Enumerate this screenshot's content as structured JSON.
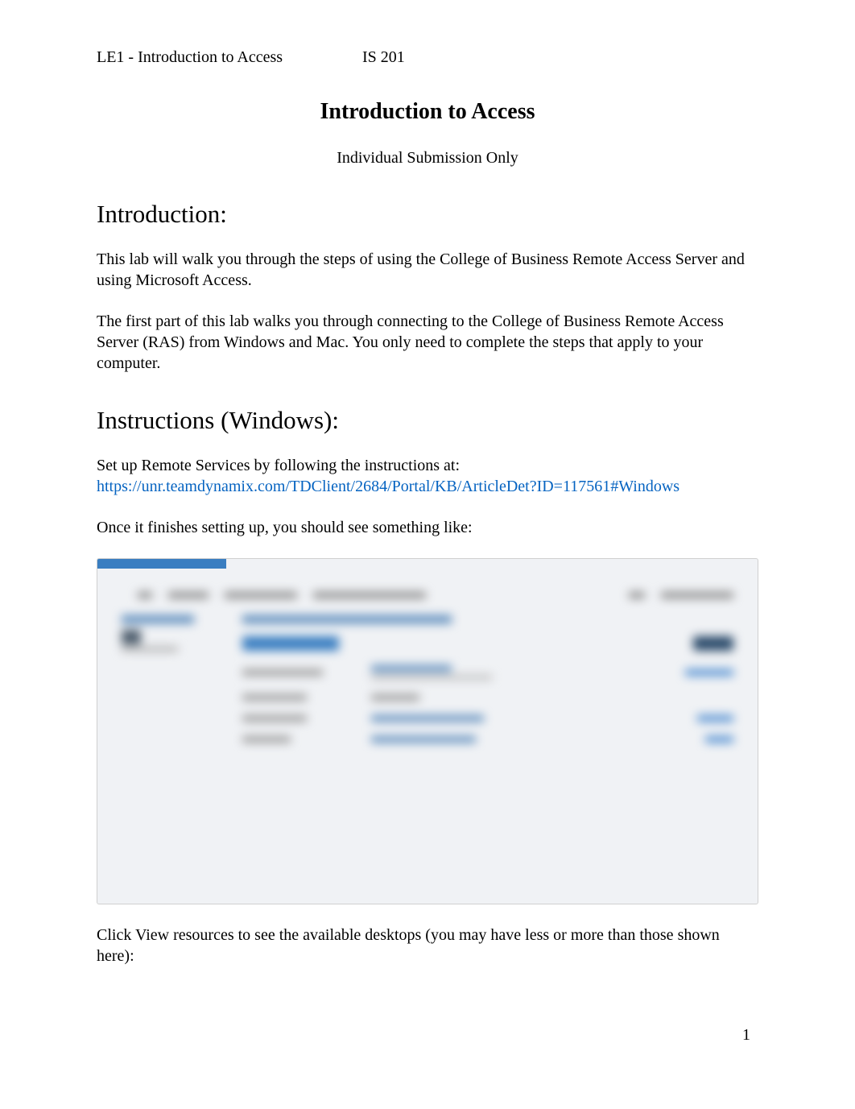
{
  "header": {
    "left": "LE1 - Introduction to Access",
    "right": "IS 201"
  },
  "title": "Introduction to Access",
  "subtitle": "Individual Submission Only",
  "sections": {
    "introduction": {
      "heading": "Introduction:",
      "para1": "This lab will walk you through the steps of using the College of Business Remote Access Server and using Microsoft Access.",
      "para2": "The first part of this lab walks you through connecting to the College of Business Remote Access Server (RAS) from Windows and Mac. You only need to complete the steps that apply to your computer."
    },
    "instructions_windows": {
      "heading": "Instructions (Windows):",
      "line1": "Set up Remote Services by following the instructions at:",
      "link": "https://unr.teamdynamix.com/TDClient/2684/Portal/KB/ArticleDet?ID=117561#Windows",
      "line2": "Once it finishes setting up, you should see something like:",
      "line3": "Click View resources to see the available desktops (you may have less or more than those shown here):"
    }
  },
  "page_number": "1"
}
